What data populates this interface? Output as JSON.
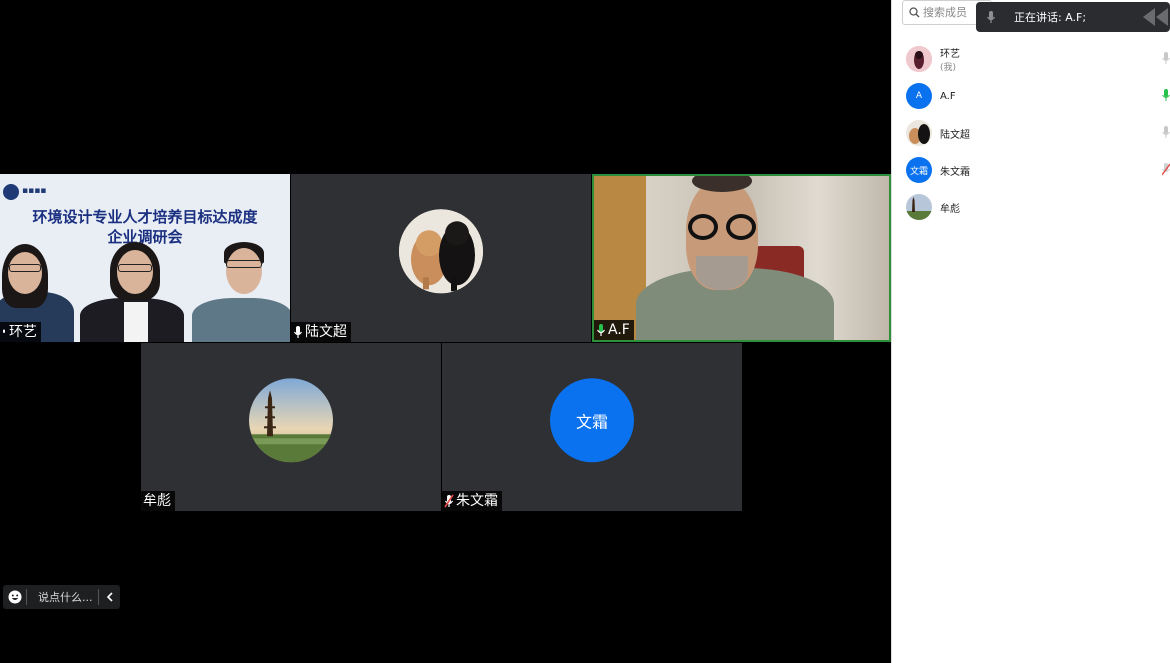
{
  "tiles": {
    "huanyi": {
      "name": "环艺",
      "banner_title_line1": "环境设计专业人才培养目标达成度",
      "banner_title_line2": "企业调研会"
    },
    "luwenchao": {
      "name": "陆文超"
    },
    "af": {
      "name": "A.F"
    },
    "moubiao": {
      "name": "牟彪"
    },
    "zhuwenshuang": {
      "name": "朱文霜",
      "initials": "文霜"
    }
  },
  "chat": {
    "placeholder": "说点什么..."
  },
  "panel": {
    "search_placeholder": "搜索成员",
    "speaking_text": "正在讲话: A.F;",
    "members": [
      {
        "name": "环艺",
        "sub": "(我)",
        "mic": "muted"
      },
      {
        "name": "A.F",
        "initials": "A",
        "mic": "active"
      },
      {
        "name": "陆文超",
        "mic": "muted"
      },
      {
        "name": "朱文霜",
        "initials": "文霜",
        "mic": "off"
      },
      {
        "name": "牟彪"
      }
    ]
  },
  "colors": {
    "accent_blue": "#0a72ef",
    "speaking_green": "#2d8f3a",
    "mic_muted_red": "#e54b4b"
  },
  "icons": {
    "search": "search-icon",
    "mic": "microphone-icon",
    "emoji": "smiley-icon",
    "collapse": "chevron-left-icon"
  }
}
